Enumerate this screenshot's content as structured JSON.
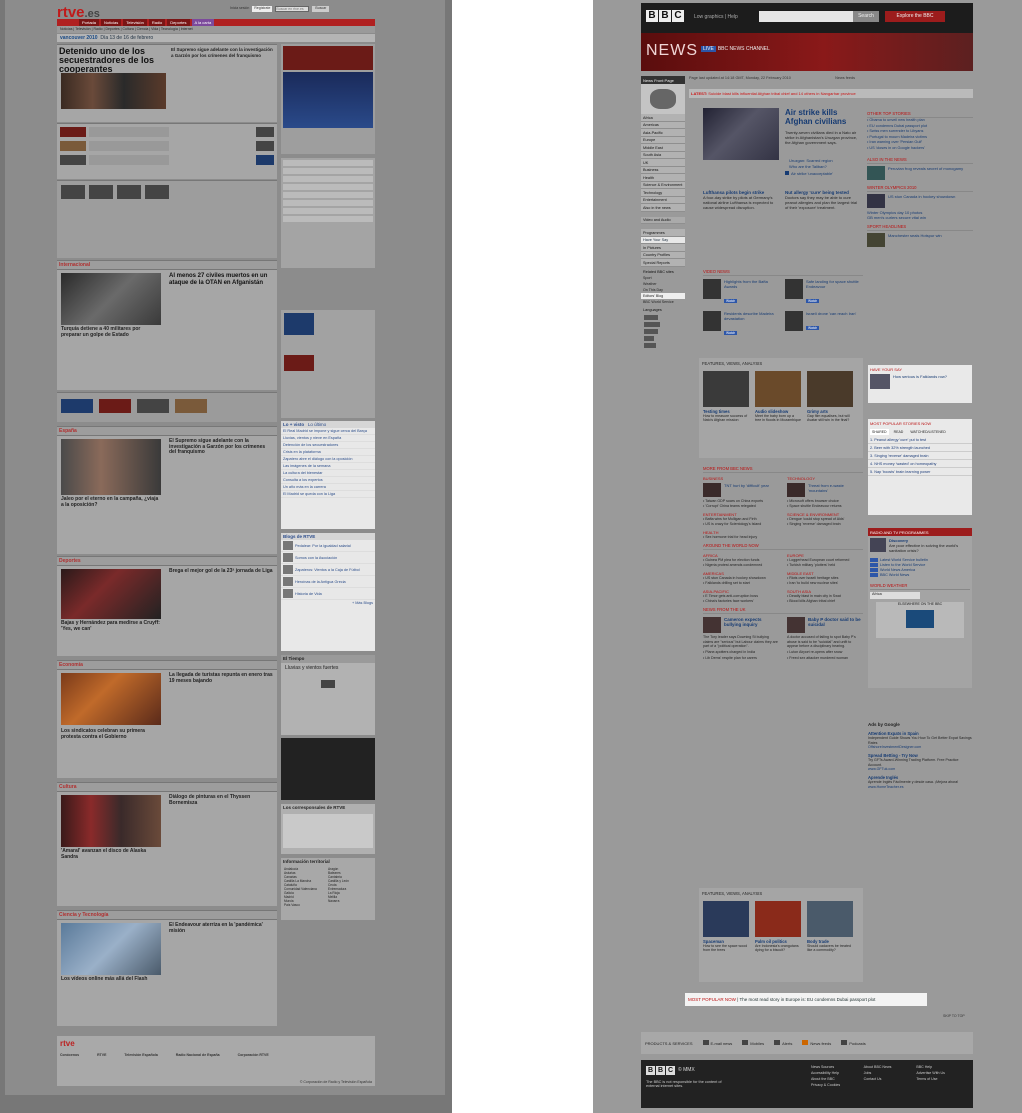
{
  "rtve": {
    "logo": "rtve",
    "logo_suffix": ".es",
    "util_links": [
      "Inicia sesión",
      "Regístrate",
      "Buscar en rtve.es",
      "Buscar"
    ],
    "nav_tabs": [
      "Portada",
      "Noticias",
      "Televisión",
      "Radio",
      "Deportes",
      "A la carta"
    ],
    "active_tab": "A la carta",
    "sub_nav": "Noticias | Televisión | Radio | Deportes | Cultura | Ciencia | Vida | Tecnología | Internet",
    "vancouver": "vancouver 2010",
    "vancouver_note": "Día 13 de 16 de febrero",
    "lead_headline": "Detenido uno de los secuestradores de los cooperantes",
    "sections": [
      "Internacional",
      "España",
      "Deportes",
      "Economía",
      "Cultura",
      "Ciencia y Tecnología"
    ],
    "section_headlines": {
      "internacional": "Al menos 27 civiles muertos en un ataque de la OTAN en Afganistán",
      "internacional_sub": "Turquía detiene a 40 militares por preparar un golpe de Estado",
      "espana": "El Supremo sigue adelante con la investigación a Garzón por los crímenes del franquismo",
      "espana_sub": "Jaleo por el eterno en la campaña, ¿viaja a la oposición?",
      "deportes": "Brega el mejor gol de la 23ª jornada de Liga",
      "deportes_sub": "Bajas y Hernández para medirse a Cruyff: 'Yes, we can'",
      "economia": "La llegada de turistas repunta en enero tras 19 meses bajando",
      "economia_sub": "Los sindicatos celebran su primera protesta contra el Gobierno",
      "cultura": "Diálogo de pinturas en el Thyssen Bornemisza",
      "cultura_sub": "'Amaral' avanzan el disco de Alaska Sandra",
      "ciencia": "El Endeavour aterriza en la 'pandémica' misión",
      "ciencia_sub": "Los vídeos online más allá del Flash"
    },
    "right_widgets": {
      "lo_mas": "Lo + visto",
      "lo_mas_tab2": "Lo último",
      "lo_mas_items": [
        "El Real Madrid se impone y sigue cerca del Barça",
        "Lluvias, vientos y nieve en España",
        "Detención de los secuestradores",
        "Crisis en la plataforma",
        "Zapatero abre el diálogo con la oposición",
        "Las imágenes de la semana",
        "La cultura del bienestar",
        "Consulta a los expertos",
        "Un año más en la carrera",
        "El Madrid se queda con la Liga"
      ],
      "blogs": "Blogs de RTVE",
      "blogs_items": [
        "Pedalear: Por la igualdad salarial",
        "Somos con la Asociación",
        "Zapateros: Vientos a la Caja de Fútbol",
        "Heroínas de la Antigua Grecia",
        "Historia de Vida"
      ],
      "ver_mas": "+ Más Blogs",
      "tiempo": "El Tiempo",
      "tiempo_text": "Lluvias y vientos fuertes",
      "corresponsales": "Los corresponsales de RTVE",
      "info_territorial": "Información territorial",
      "regions": [
        "Andalucía",
        "Aragón",
        "Asturias",
        "Baleares",
        "Canarias",
        "Cantabria",
        "Castilla La Mancha",
        "Castilla y León",
        "Cataluña",
        "Ceuta",
        "Comunidad Valenciana",
        "Extremadura",
        "Galicia",
        "La Rioja",
        "Madrid",
        "Melilla",
        "Murcia",
        "Navarra",
        "País Vasco"
      ]
    },
    "footer_links": [
      "Conócenos",
      "RTVE",
      "Televisión Española",
      "Radio Nacional de España",
      "Corporación RTVE"
    ],
    "footer_copyright": "© Corporación de Radio y Televisión Española"
  },
  "bbc": {
    "logo": [
      "B",
      "B",
      "C"
    ],
    "top_links": "Low graphics | Help",
    "search_button": "Search",
    "explore": "Explore the BBC",
    "news_title": "NEWS",
    "live_badge": "LIVE",
    "live_text": "BBC NEWS CHANNEL",
    "updated": "Page last updated at 14:18 GMT, Monday, 22 February 2010",
    "news_feeds": "News feeds",
    "latest_label": "LATEST:",
    "latest_text": "Suicide blast kills influential Afghan tribal chief and 14 others in Nangarhar province",
    "left_nav": {
      "header": "News Front Page",
      "items": [
        "Africa",
        "Americas",
        "Asia-Pacific",
        "Europe",
        "Middle East",
        "South Asia",
        "UK",
        "Business",
        "Health",
        "Science & Environment",
        "Technology",
        "Entertainment",
        "Also in the news"
      ],
      "av": "Video and Audio",
      "programmes_items": [
        "Programmes",
        "Have Your Say",
        "In Pictures",
        "Country Profiles",
        "Special Reports"
      ],
      "selected": "Have Your Say",
      "related": "Related BBC sites",
      "related_items": [
        "Sport",
        "Weather",
        "On This Day",
        "Editors' Blog",
        "BBC World Service"
      ],
      "related_selected": "Editors' Blog",
      "languages": "Languages"
    },
    "lead": {
      "headline": "Air strike kills Afghan civilians",
      "summary": "Twenty-seven civilians died in a Nato air strike in Afghanistan's Uruzgan province, the Afghan government says.",
      "bullets": [
        "Uruzgan: Scarred region",
        "Who are the Taliban?"
      ],
      "video": "Air strike 'unacceptable'"
    },
    "two_stories": [
      {
        "headline": "Lufthansa pilots begin strike",
        "text": "A four-day strike by pilots at Germany's national airline Lufthansa is expected to cause widespread disruption."
      },
      {
        "headline": "Nut allergy 'cure' being tested",
        "text": "Doctors say they may be able to cure peanut allergies and plan the largest trial of their 'exposure' treatment."
      }
    ],
    "video_news": "VIDEO NEWS",
    "videos": [
      {
        "title": "Highlights from the Bafta Awards",
        "badge": "Watch"
      },
      {
        "title": "Safe landing for space shuttle Endeavour",
        "badge": "Watch"
      },
      {
        "title": "Residents describe Madeira devastation",
        "badge": "Watch"
      },
      {
        "title": "Israeli drone 'can reach Iran'",
        "badge": "Watch"
      }
    ],
    "features": "FEATURES, VIEWS, ANALYSIS",
    "feature_items": [
      {
        "title": "Testing times",
        "text": "How to measure success of Nato's Afghan mission"
      },
      {
        "title": "Audio slideshow",
        "text": "Meet the baby born up a tree in floods in Mozambique"
      },
      {
        "title": "Grimy arts",
        "text": "Gap film equalises, but will Avatar still win in the final?"
      }
    ],
    "more_from": "MORE FROM BBC NEWS",
    "categories": [
      {
        "name": "BUSINESS",
        "lead": "TNT hurt by 'difficult' year",
        "items": [
          "Taiwan GDP soars on China exports",
          "'Corrupt' China teams relegated"
        ]
      },
      {
        "name": "TECHNOLOGY",
        "lead": "Threat from e-waste 'mountains'",
        "items": [
          "Microsoft offers browser choice",
          "Space shuttle Endeavour returns"
        ]
      },
      {
        "name": "ENTERTAINMENT",
        "lead": "",
        "items": [
          "Bafta wins for Mulligan and Firth",
          "US is crazy for Scientology's Island"
        ]
      },
      {
        "name": "SCIENCE & ENVIRONMENT",
        "lead": "",
        "items": [
          "Dengue 'could stop spread of Aids'",
          "Singing 'reverse' damaged brain"
        ]
      },
      {
        "name": "HEALTH",
        "lead": "",
        "items": [
          "Sex hormone trial for head injury"
        ]
      }
    ],
    "around_world": "AROUND THE WORLD NOW",
    "world_regions": [
      {
        "name": "AFRICA",
        "items": [
          "Guinea PM plea for election funds",
          "Nigeria protest amends condemned"
        ]
      },
      {
        "name": "EUROPE",
        "items": [
          "Loggerhead European court reformed",
          "Turkish military 'plotters' held"
        ]
      },
      {
        "name": "AMERICAS",
        "items": [
          "US stun Canada in hockey showdown",
          "Falklands drilling set to start"
        ]
      },
      {
        "name": "MIDDLE EAST",
        "items": [
          "Riots over Israeli heritage sites",
          "Iran 'to build new nuclear sites'"
        ]
      },
      {
        "name": "ASIA-PACIFIC",
        "items": [
          "E Timor gets anti-corruption boss",
          "China's factories face workers'"
        ]
      },
      {
        "name": "SOUTH ASIA",
        "items": [
          "Deadly blast in main city in Swat",
          "Blood kills Afghan tribal chief"
        ]
      }
    ],
    "news_uk": "NEWS FROM THE UK",
    "uk_stories": [
      {
        "headline": "Cameron expects bullying inquiry",
        "text": "The Tory leader says Downing St bullying claims are \"serious\" but Labour claims they are part of a \"political operation\".",
        "items": [
          "Plane-spotters charged in India",
          "Lib Dems' respite plan for carers"
        ]
      },
      {
        "headline": "Baby P doctor said to be suicidal",
        "text": "A doctor accused of failing to spot Baby P's abuse is said to be \"suicidal\" and unfit to appear before a disciplinary hearing.",
        "items": [
          "Luton Airport re-opens after snow",
          "Freed sex attacker murdered woman"
        ]
      }
    ],
    "features2": [
      {
        "title": "Spaceman",
        "text": "How to see the space wood from the trees"
      },
      {
        "title": "Palm oil politics",
        "text": "Are Indonesia's orangutans dying for a biscuit?"
      },
      {
        "title": "Body trade",
        "text": "Should cadavers be treated like a commodity?"
      }
    ],
    "right": {
      "other_top": "OTHER TOP STORIES",
      "other_items": [
        "Obama to unveil new health plan",
        "EU condemns Dubai passport plot",
        "Swiss men surrender to Libyans",
        "Portugal to mourn Madeira victims",
        "Iran warning over 'Persian Gulf'",
        "US 'closes in on Google hackers'"
      ],
      "also": "ALSO IN THE NEWS",
      "also_item": "Peruvian frog reveals secret of monogamy",
      "winter": "WINTER OLYMPICS 2010",
      "winter_lead": "US stun Canada in hockey showdown",
      "winter_items": [
        "Winter Olympics day 10 photos",
        "GB men's curlers secure vital win"
      ],
      "sport": "SPORT HEADLINES",
      "sport_item": "Manchester seals Hotspur win",
      "hys": "HAVE YOUR SAY",
      "hys_item": "How serious is Falklands row?",
      "most_pop": "MOST POPULAR STORIES NOW",
      "most_pop_tabs": [
        "SHARED",
        "READ",
        "WATCHED/LISTENED"
      ],
      "most_pop_items": [
        "Peanut allergy 'cure' put to test",
        "Beer with 32% strength launched",
        "Singing 'reverse' damaged brain",
        "NHS money 'wasted' on homeopathy",
        "Nap 'boosts' brain learning power"
      ],
      "radio": "RADIO AND TV PROGRAMMES",
      "radio_title": "Discovery",
      "radio_text": "Are poor effective in solving the world's sanitation crisis?",
      "radio_items": [
        "Latest World Service bulletin",
        "Listen to the World Service",
        "World News America",
        "BBC World News"
      ],
      "weather": "WORLD WEATHER",
      "weather_select": "Africa",
      "elsewhere": "ELSEWHERE ON THE BBC",
      "ads_title": "Ads by Google",
      "ads": [
        {
          "title": "Attention Expats in Spain",
          "text": "Independent Guide Shows You How To Get Better Expat Savings Rates",
          "url": "OffshoreInvestmentDesigner.com"
        },
        {
          "title": "Spread Betting - Try Now",
          "text": "Try GFTs Award-Winning Trading Platform. Free Practice Account.",
          "url": "www.GFTuk.com"
        },
        {
          "title": "Aprende Inglés",
          "text": "Aprende Inglés Fácilmente y desde casa. ¡Mejora ahora!",
          "url": "www.HomeTeacher.es"
        }
      ]
    },
    "most_pop_now_label": "MOST POPULAR NOW",
    "most_pop_now_text": "The most read story in Europe is: EU condemns Dubai passport plot",
    "skip_top": "SKIP TO TOP",
    "products": "PRODUCTS & SERVICES",
    "product_items": [
      "E-mail news",
      "Mobiles",
      "Alerts",
      "News feeds",
      "Podcasts"
    ],
    "footer_logo": [
      "B",
      "B",
      "C"
    ],
    "footer_mmx": "© MMX",
    "footer_note": "The BBC is not responsible for the content of external internet sites.",
    "footer_links": [
      "News Sources",
      "About BBC News",
      "BBC Help",
      "Accessibility Help",
      "Jobs",
      "Advertise With Us",
      "About the BBC",
      "Contact Us",
      "Terms of Use",
      "Privacy & Cookies"
    ]
  }
}
